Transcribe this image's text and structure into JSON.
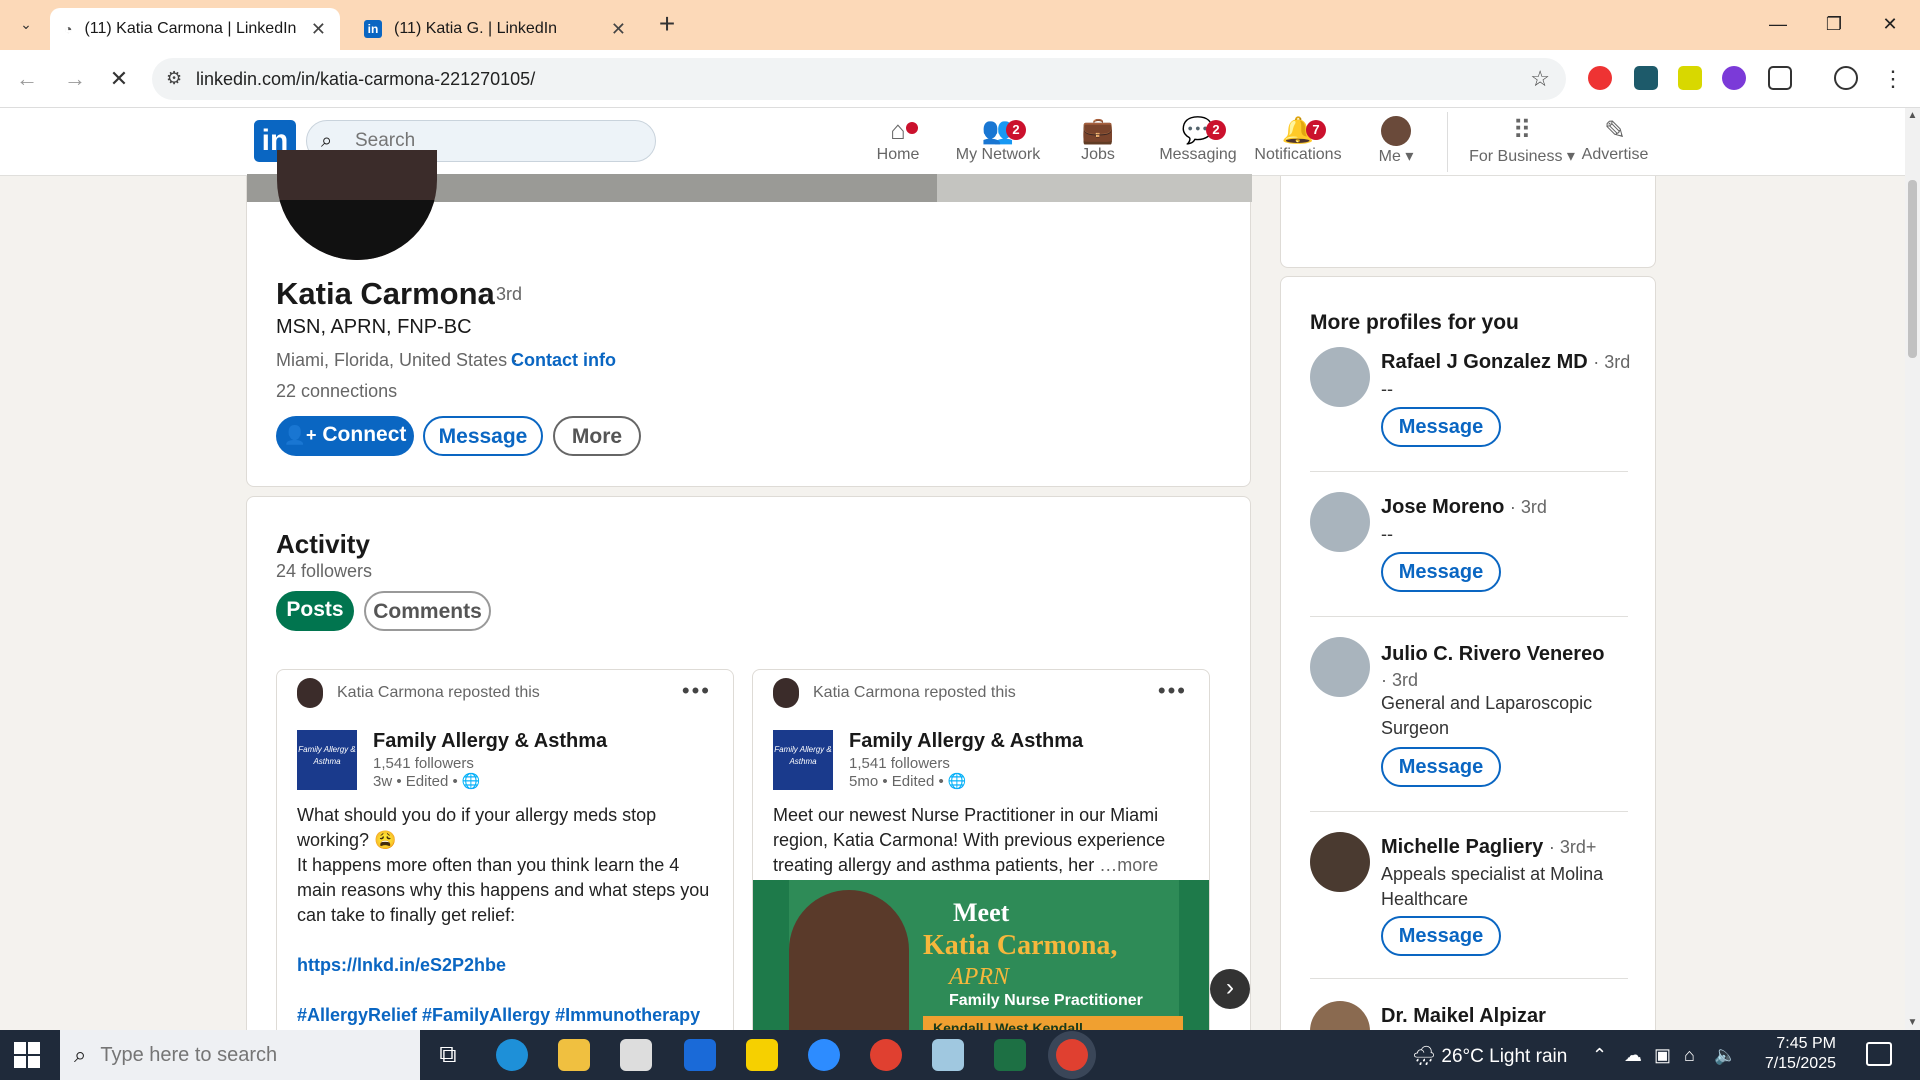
{
  "browser": {
    "tabs": [
      {
        "label": "(11) Katia Carmona | LinkedIn",
        "active": true
      },
      {
        "label": "(11) Katia G. | LinkedIn",
        "active": false
      }
    ],
    "url": "linkedin.com/in/katia-carmona-221270105/"
  },
  "linkedin": {
    "search_placeholder": "Search",
    "nav": [
      {
        "label": "Home",
        "icon": "home-icon",
        "badge": ""
      },
      {
        "label": "My Network",
        "icon": "network-icon",
        "badge": "2"
      },
      {
        "label": "Jobs",
        "icon": "briefcase-icon",
        "badge": ""
      },
      {
        "label": "Messaging",
        "icon": "message-icon",
        "badge": "2"
      },
      {
        "label": "Notifications",
        "icon": "bell-icon",
        "badge": "7"
      },
      {
        "label": "Me ▾",
        "icon": "avatar",
        "badge": ""
      },
      {
        "label": "For Business ▾",
        "icon": "grid-icon",
        "badge": ""
      },
      {
        "label": "Advertise",
        "icon": "advertise-icon",
        "badge": ""
      }
    ]
  },
  "profile": {
    "name": "Katia Carmona",
    "degree": "· 3rd",
    "headline": "MSN, APRN, FNP-BC",
    "location": "Miami, Florida, United States ·",
    "contact_info": "Contact info",
    "connections": "22 connections",
    "buttons": {
      "connect": "Connect",
      "message": "Message",
      "more": "More"
    }
  },
  "activity": {
    "title": "Activity",
    "followers": "24 followers",
    "tabs": [
      "Posts",
      "Comments"
    ],
    "posts": [
      {
        "reposted": "Katia Carmona reposted this",
        "org": "Family Allergy & Asthma",
        "org_logo": "Family Allergy & Asthma",
        "followers": "1,541 followers",
        "meta": "3w • Edited • 🌐",
        "text1": "What should you do if your allergy meds stop working? 😩",
        "text2": "It happens more often than you think learn the 4 main reasons why this happens and what steps you can take to finally get relief:",
        "link": "https://lnkd.in/eS2P2hbe",
        "tags": "#AllergyRelief #FamilyAllergy #Immunotherapy"
      },
      {
        "reposted": "Katia Carmona reposted this",
        "org": "Family Allergy & Asthma",
        "org_logo": "Family Allergy & Asthma",
        "followers": "1,541 followers",
        "meta": "5mo • Edited • 🌐",
        "text1": "Meet our newest Nurse Practitioner in our Miami region, Katia Carmona! With previous experience treating allergy and asthma patients, her",
        "more": "…more",
        "image": {
          "meet": "Meet",
          "name": "Katia Carmona,",
          "cred": "APRN",
          "role": "Family Nurse Practitioner",
          "locations": "Kendall | West Kendall"
        }
      }
    ]
  },
  "sidebar": {
    "title": "More profiles for you",
    "button_label": "Message",
    "profiles": [
      {
        "name": "Rafael J Gonzalez MD",
        "degree": "· 3rd",
        "sub": "--"
      },
      {
        "name": "Jose Moreno",
        "degree": "· 3rd",
        "sub": "--"
      },
      {
        "name": "Julio C. Rivero Venereo",
        "degree": "· 3rd",
        "sub": "General and Laparoscopic Surgeon"
      },
      {
        "name": "Michelle Pagliery",
        "degree": "· 3rd+",
        "sub": "Appeals specialist at Molina Healthcare"
      },
      {
        "name": "Dr. Maikel Alpizar",
        "degree": "",
        "sub": ""
      }
    ]
  },
  "taskbar": {
    "search_placeholder": "Type here to search",
    "weather": "26°C  Light rain",
    "time": "7:45 PM",
    "date": "7/15/2025"
  }
}
